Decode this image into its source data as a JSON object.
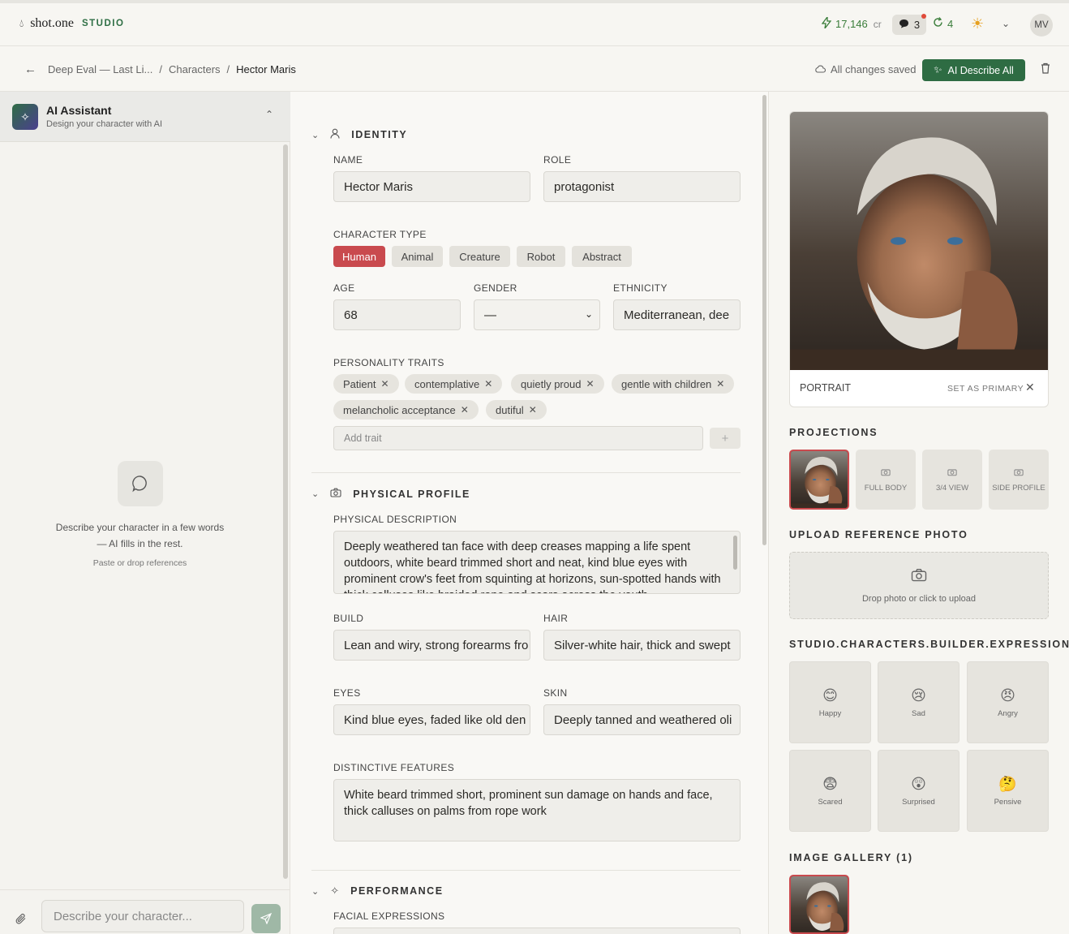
{
  "app": {
    "brand": "shot.one",
    "studio": "STUDIO"
  },
  "topbar": {
    "credits": "17,146",
    "credits_unit": "cr",
    "messages_count": "3",
    "sync_count": "4",
    "avatar": "MV"
  },
  "breadcrumb": {
    "project": "Deep Eval — Last Li...",
    "sep1": "/",
    "section": "Characters",
    "sep2": "/",
    "current": "Hector Maris"
  },
  "save_status": "All changes saved",
  "ai_describe_label": "AI Describe All",
  "assistant": {
    "title": "AI Assistant",
    "subtitle": "Design your character with AI",
    "empty_line1": "Describe your character in a few words",
    "empty_line2": "— AI fills in the rest.",
    "empty_hint": "Paste or drop references",
    "input_placeholder": "Describe your character..."
  },
  "identity": {
    "section_title": "IDENTITY",
    "name_label": "NAME",
    "name_value": "Hector Maris",
    "role_label": "ROLE",
    "role_value": "protagonist",
    "type_label": "CHARACTER TYPE",
    "types": [
      "Human",
      "Animal",
      "Creature",
      "Robot",
      "Abstract"
    ],
    "selected_type": "Human",
    "age_label": "AGE",
    "age_value": "68",
    "gender_label": "GENDER",
    "gender_value": "—",
    "ethnicity_label": "ETHNICITY",
    "ethnicity_value": "Mediterranean, dee",
    "traits_label": "PERSONALITY TRAITS",
    "traits": [
      "Patient",
      "contemplative",
      "quietly proud",
      "gentle with children",
      "melancholic acceptance",
      "dutiful"
    ],
    "add_trait_placeholder": "Add trait",
    "add_trait_button": "+"
  },
  "physical": {
    "section_title": "PHYSICAL PROFILE",
    "desc_label": "PHYSICAL DESCRIPTION",
    "desc_value": "Deeply weathered tan face with deep creases mapping a life spent outdoors, white beard trimmed short and neat, kind blue eyes with prominent crow's feet from squinting at horizons, sun-spotted hands with thick calluses like braided rope and scars across the youth",
    "build_label": "BUILD",
    "build_value": "Lean and wiry, strong forearms fro",
    "hair_label": "HAIR",
    "hair_value": "Silver-white hair, thick and swept",
    "eyes_label": "EYES",
    "eyes_value": "Kind blue eyes, faded like old den",
    "skin_label": "SKIN",
    "skin_value": "Deeply tanned and weathered oli",
    "features_label": "DISTINCTIVE FEATURES",
    "features_value": "White beard trimmed short, prominent sun damage on hands and face, thick calluses on palms from rope work"
  },
  "performance": {
    "section_title": "PERFORMANCE",
    "facial_label": "FACIAL EXPRESSIONS"
  },
  "portrait": {
    "label": "PORTRAIT",
    "set_primary": "SET AS PRIMARY"
  },
  "projections": {
    "title": "PROJECTIONS",
    "items": [
      "FULL BODY",
      "3/4 VIEW",
      "SIDE PROFILE"
    ]
  },
  "upload": {
    "title": "UPLOAD REFERENCE PHOTO",
    "text": "Drop photo or click to upload"
  },
  "expressions": {
    "title": "STUDIO.CHARACTERS.BUILDER.EXPRESSIONSH",
    "items": [
      {
        "emoji": "😊",
        "label": "Happy"
      },
      {
        "emoji": "😢",
        "label": "Sad"
      },
      {
        "emoji": "😠",
        "label": "Angry"
      },
      {
        "emoji": "😨",
        "label": "Scared"
      },
      {
        "emoji": "😲",
        "label": "Surprised"
      },
      {
        "emoji": "🤔",
        "label": "Pensive"
      }
    ]
  },
  "gallery": {
    "title": "IMAGE GALLERY (1)"
  },
  "colors": {
    "brand_green": "#2e6c43",
    "accent_red": "#c94a4e"
  }
}
